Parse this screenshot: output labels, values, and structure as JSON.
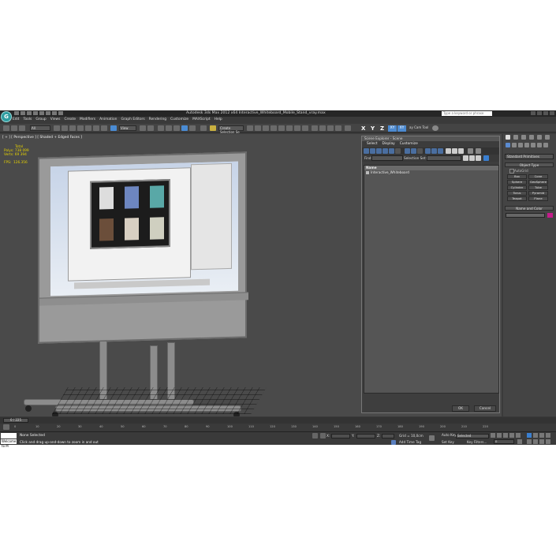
{
  "title_bar": {
    "app_logo": "G",
    "title": "Autodesk 3ds Max  2012 x64     Interactive_Whiteboard_Mobile_Stand_vray.max",
    "search_placeholder": "Type a keyword or phrase"
  },
  "menu": [
    "Edit",
    "Tools",
    "Group",
    "Views",
    "Create",
    "Modifiers",
    "Animation",
    "Graph Editors",
    "Rendering",
    "Customize",
    "MAXScript",
    "Help"
  ],
  "main_toolbar": {
    "selection_filter": "All",
    "reference_coord": "View",
    "named_selection": "Create Selection Se",
    "axes": [
      "X",
      "Y",
      "Z"
    ],
    "axis_constraints": [
      "XY",
      "XY"
    ],
    "rendering_tool": "ay Cam Tool"
  },
  "viewport": {
    "label": "[ + ] [ Perspective ] [ Shaded + Edged Faces ]",
    "stats": {
      "header": "Total",
      "polys_label": "Polys:",
      "polys_value": "738 099",
      "verts_label": "Verts:",
      "verts_value": "69 394",
      "fps_label": "FPS:",
      "fps_value": "126.356"
    }
  },
  "scene_explorer": {
    "title": "Scene Explorer - Scene",
    "menus": [
      "Select",
      "Display",
      "Customize"
    ],
    "find_label": "Find:",
    "selection_set_label": "Selection Set:",
    "column_header": "Name",
    "items": [
      "Interactive_Whiteboard"
    ],
    "ok_label": "OK",
    "cancel_label": "Cancel"
  },
  "command_panel": {
    "category": "Standard Primitives",
    "object_type_title": "Object Type",
    "autogrid_label": "AutoGrid",
    "objects": [
      "Box",
      "Cone",
      "Sphere",
      "GeoSphere",
      "Cylinder",
      "Tube",
      "Torus",
      "Pyramid",
      "Teapot",
      "Plane"
    ],
    "name_color_title": "Name and Color",
    "color": "#c41c8b"
  },
  "time": {
    "slider_label": "0 / 225",
    "ticks": [
      "0",
      "10",
      "20",
      "30",
      "40",
      "50",
      "60",
      "70",
      "80",
      "90",
      "100",
      "110",
      "120",
      "130",
      "140",
      "150",
      "160",
      "170",
      "180",
      "190",
      "200",
      "210",
      "220"
    ]
  },
  "status_bar": {
    "welcome": "Welcome to M",
    "status": "None Selected",
    "prompt": "Click and drag up-and-down to zoom in and out",
    "x_label": "X:",
    "y_label": "Y:",
    "z_label": "Z:",
    "grid": "Grid = 10,0cm",
    "autokey_label": "Auto Key",
    "autokey_value": "Selected",
    "setkey_label": "Set Key",
    "key_filters": "Key Filters...",
    "add_time_tag": "Add Time Tag",
    "frame_value": "0"
  }
}
